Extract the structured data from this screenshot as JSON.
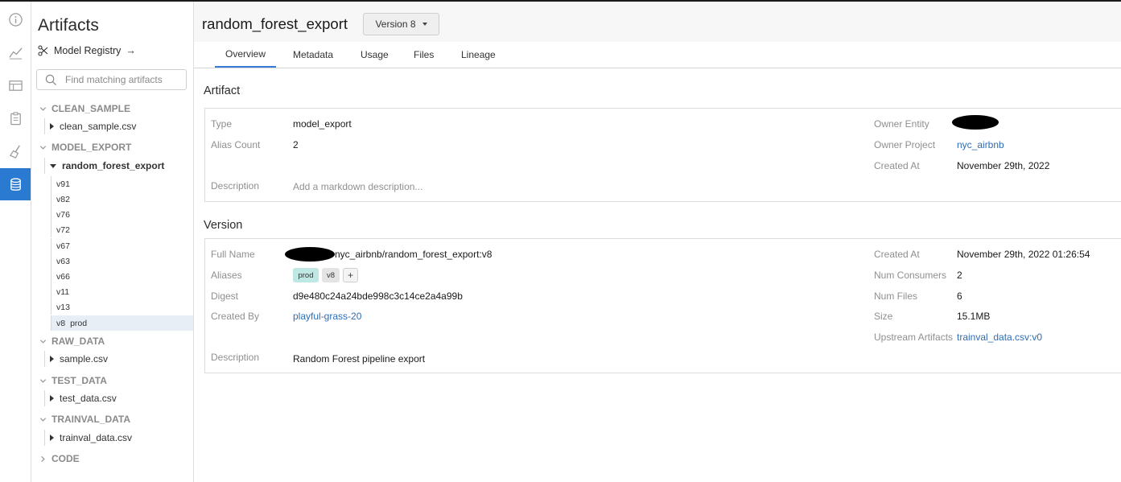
{
  "sidebar": {
    "title": "Artifacts",
    "registry_label": "Model Registry",
    "registry_arrow": "→",
    "search_placeholder": "Find matching artifacts",
    "groups": [
      {
        "name": "CLEAN_SAMPLE",
        "items": [
          "clean_sample.csv"
        ]
      },
      {
        "name": "MODEL_EXPORT",
        "items": [
          "random_forest_export"
        ]
      },
      {
        "name": "RAW_DATA",
        "items": [
          "sample.csv"
        ]
      },
      {
        "name": "TEST_DATA",
        "items": [
          "test_data.csv"
        ]
      },
      {
        "name": "TRAINVAL_DATA",
        "items": [
          "trainval_data.csv"
        ]
      },
      {
        "name": "CODE",
        "items": []
      }
    ],
    "versions": [
      "v91",
      "v82",
      "v76",
      "v72",
      "v67",
      "v63",
      "v66",
      "v11",
      "v13",
      "v8"
    ],
    "selected_version_alias": "prod"
  },
  "header": {
    "title": "random_forest_export",
    "version_label": "Version 8"
  },
  "tabs": [
    "Overview",
    "Metadata",
    "Usage",
    "Files",
    "Lineage"
  ],
  "artifact": {
    "section_title": "Artifact",
    "type_label": "Type",
    "type_value": "model_export",
    "alias_count_label": "Alias Count",
    "alias_count_value": "2",
    "description_label": "Description",
    "description_placeholder": "Add a markdown description...",
    "owner_entity_label": "Owner Entity",
    "owner_project_label": "Owner Project",
    "owner_project_value": "nyc_airbnb",
    "created_at_label": "Created At",
    "created_at_value": "November 29th, 2022"
  },
  "version": {
    "section_title": "Version",
    "full_name_label": "Full Name",
    "full_name_value": "nyc_airbnb/random_forest_export:v8",
    "aliases_label": "Aliases",
    "aliases": [
      "prod",
      "v8"
    ],
    "add_alias": "+",
    "digest_label": "Digest",
    "digest_value": "d9e480c24a24bde998c3c14ce2a4a99b",
    "created_by_label": "Created By",
    "created_by_value": "playful-grass-20",
    "description_label": "Description",
    "description_value": "Random Forest pipeline export",
    "created_at_label": "Created At",
    "created_at_value": "November 29th, 2022 01:26:54",
    "num_consumers_label": "Num Consumers",
    "num_consumers_value": "2",
    "num_files_label": "Num Files",
    "num_files_value": "6",
    "size_label": "Size",
    "size_value": "15.1MB",
    "upstream_label": "Upstream Artifacts",
    "upstream_value": "trainval_data.csv:v0"
  },
  "colors": {
    "accent": "#2a7ad2",
    "link": "#2e6db3",
    "prod_tag": "#bfe8e5"
  }
}
